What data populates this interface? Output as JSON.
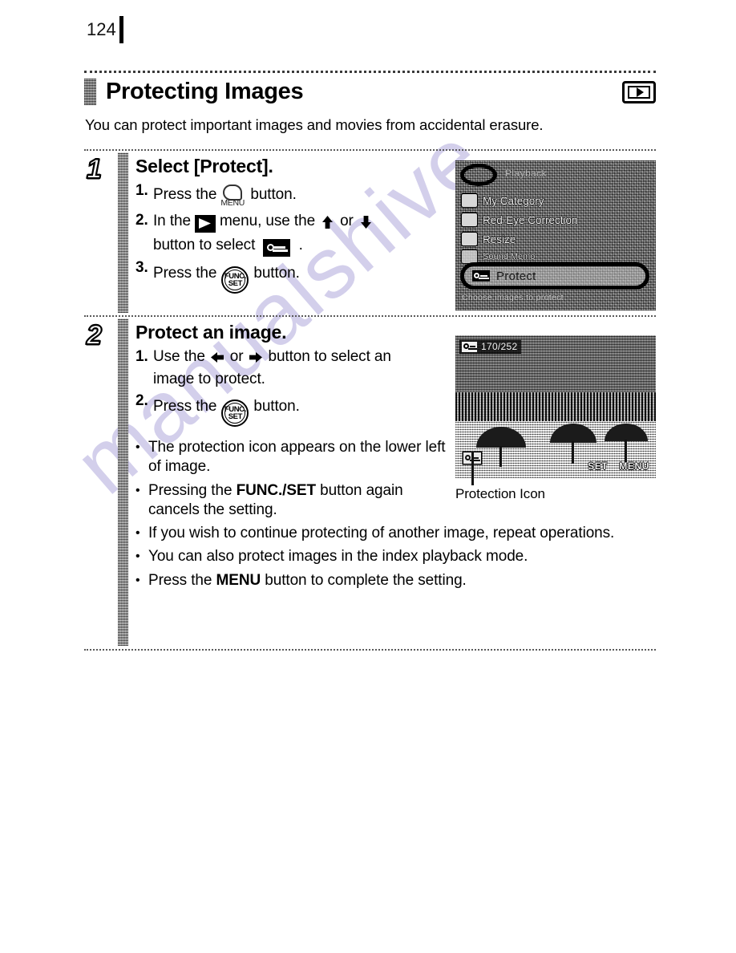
{
  "page": {
    "number": "124"
  },
  "header": {
    "title": "Protecting Images",
    "badge_icon": "playback-mode-icon"
  },
  "intro": "You can protect important images and movies from accidental erasure.",
  "watermark": "manualshive",
  "steps": [
    {
      "number": "1",
      "title": "Select [Protect].",
      "items": [
        {
          "marker": "1.",
          "before": "Press the",
          "icon": "menu-button-icon",
          "icon_label": "MENU",
          "after": "button."
        },
        {
          "marker": "2.",
          "before": "In the",
          "icon": "playback-mode-icon",
          "mid": "menu, use the",
          "icon2": "up-arrow-icon",
          "or": "or",
          "icon3": "down-arrow-icon",
          "line2_before": "button to select",
          "icon4": "protect-key-icon",
          "line2_after": "."
        },
        {
          "marker": "3.",
          "before": "Press the",
          "icon": "func-set-button-icon",
          "icon_line1": "FUNC.",
          "icon_line2": "SET",
          "after": "button."
        }
      ]
    },
    {
      "number": "2",
      "title": "Protect an image.",
      "items": [
        {
          "marker": "1.",
          "before": "Use the",
          "icon": "left-arrow-icon",
          "or": "or",
          "icon2": "right-arrow-icon",
          "after": "button to select an",
          "line2": "image to protect."
        },
        {
          "marker": "2.",
          "before": "Press the",
          "icon": "func-set-button-icon",
          "icon_line1": "FUNC.",
          "icon_line2": "SET",
          "after": "button."
        }
      ],
      "bullets": [
        {
          "parts": [
            {
              "text": "The protection icon appears on the lower left of image.",
              "bold": false
            }
          ],
          "narrow": true
        },
        {
          "parts": [
            {
              "text": "Pressing the ",
              "bold": false
            },
            {
              "text": "FUNC./SET",
              "bold": true
            },
            {
              "text": " button again cancels the setting.",
              "bold": false
            }
          ],
          "narrow": true
        },
        {
          "parts": [
            {
              "text": "If you wish to continue protecting of another image, repeat operations.",
              "bold": false
            }
          ],
          "narrow": false
        },
        {
          "parts": [
            {
              "text": "You can also protect images in the index playback mode.",
              "bold": false
            }
          ],
          "narrow": false
        },
        {
          "parts": [
            {
              "text": "Press the ",
              "bold": false
            },
            {
              "text": "MENU",
              "bold": true
            },
            {
              "text": " button to complete the setting.",
              "bold": false
            }
          ],
          "narrow": false
        }
      ]
    }
  ],
  "screenshot_menu": {
    "tab_label": "Playback",
    "rows": [
      {
        "label": "My Category"
      },
      {
        "label": "Red-Eye Correction"
      },
      {
        "label": "Resize"
      },
      {
        "label": "Sound Memo"
      }
    ],
    "highlighted": "Protect",
    "bottom_hint": "Choose images to protect"
  },
  "screenshot_photo": {
    "counter": "170/252",
    "hint_set": "SET",
    "hint_menu": "MENU"
  },
  "caption": {
    "protection_icon": "Protection Icon"
  }
}
